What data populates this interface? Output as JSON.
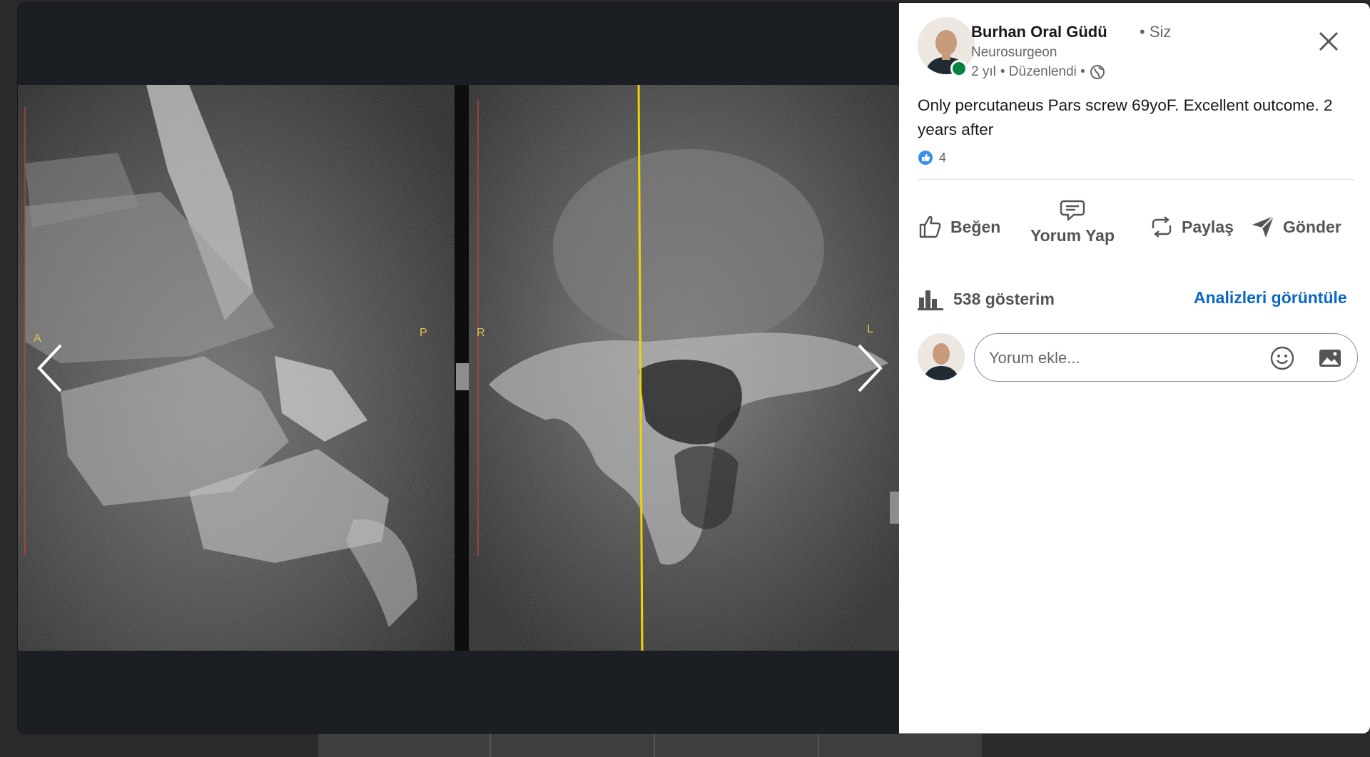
{
  "post": {
    "author_name": "Burhan Oral Güdü",
    "author_badge": "• Siz",
    "author_title": "Neurosurgeon",
    "age": "2 yıl",
    "edited": "• Düzenlendi •",
    "text": "Only percutaneus Pars screw 69yoF. Excellent outcome. 2 years after",
    "reaction_count": "4"
  },
  "actions": {
    "like": "Beğen",
    "comment": "Yorum Yap",
    "repost": "Paylaş",
    "send": "Gönder"
  },
  "stats": {
    "impressions": "538 gösterim",
    "analytics_link": "Analizleri görüntüle"
  },
  "comment": {
    "placeholder": "Yorum ekle..."
  },
  "scan_labels": {
    "left_a": "A",
    "left_p": "P",
    "right_r": "R",
    "right_l": "L"
  },
  "colors": {
    "accent": "#0a66c2",
    "online": "#058343",
    "marker_yellow": "#f2d400"
  },
  "icons": [
    "close-icon",
    "globe-icon",
    "like-icon",
    "comment-icon",
    "repost-icon",
    "send-icon",
    "analytics-icon",
    "emoji-icon",
    "image-icon",
    "chevron-left-icon",
    "chevron-right-icon",
    "reaction-like-icon"
  ]
}
